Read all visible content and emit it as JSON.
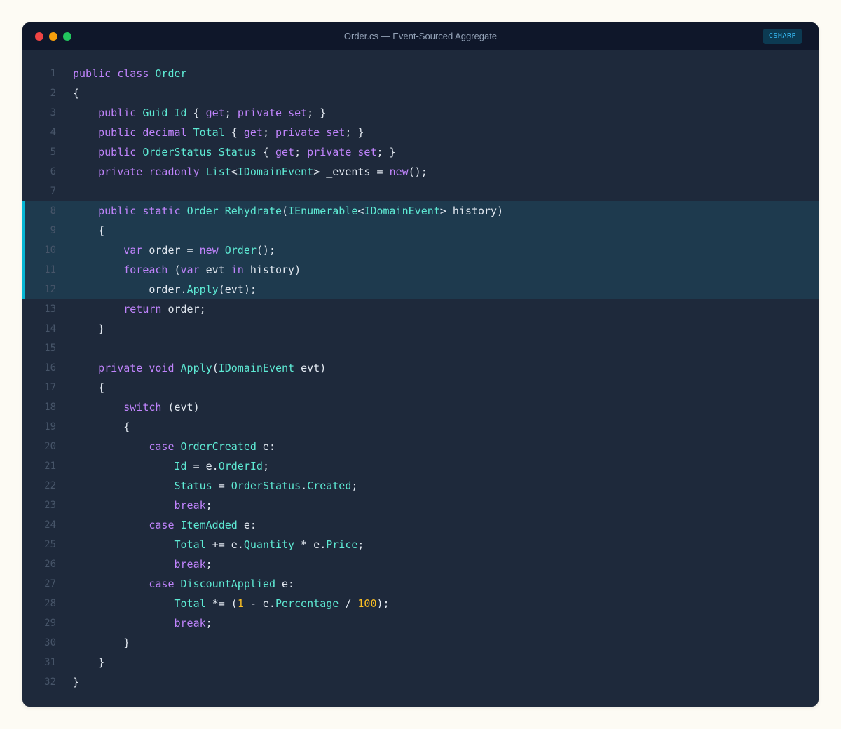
{
  "window": {
    "title": "Order.cs — Event-Sourced Aggregate",
    "language_badge": "CSHARP"
  },
  "colors": {
    "keyword": "#c084fc",
    "type": "#5eead4",
    "number": "#fbbf24",
    "text": "#e2e8f0",
    "highlight_bar": "#06b6d4"
  },
  "editor": {
    "highlighted_lines": [
      8,
      9,
      10,
      11,
      12
    ],
    "lines": [
      {
        "n": "1",
        "tokens": [
          [
            "kw",
            "public"
          ],
          [
            "tx",
            " "
          ],
          [
            "kw",
            "class"
          ],
          [
            "tx",
            " "
          ],
          [
            "ty",
            "Order"
          ]
        ]
      },
      {
        "n": "2",
        "tokens": [
          [
            "tx",
            "{"
          ]
        ]
      },
      {
        "n": "3",
        "tokens": [
          [
            "tx",
            "    "
          ],
          [
            "kw",
            "public"
          ],
          [
            "tx",
            " "
          ],
          [
            "ty",
            "Guid"
          ],
          [
            "tx",
            " "
          ],
          [
            "ty",
            "Id"
          ],
          [
            "tx",
            " { "
          ],
          [
            "kw",
            "get"
          ],
          [
            "tx",
            "; "
          ],
          [
            "kw",
            "private"
          ],
          [
            "tx",
            " "
          ],
          [
            "kw",
            "set"
          ],
          [
            "tx",
            "; }"
          ]
        ]
      },
      {
        "n": "4",
        "tokens": [
          [
            "tx",
            "    "
          ],
          [
            "kw",
            "public"
          ],
          [
            "tx",
            " "
          ],
          [
            "kw",
            "decimal"
          ],
          [
            "tx",
            " "
          ],
          [
            "ty",
            "Total"
          ],
          [
            "tx",
            " { "
          ],
          [
            "kw",
            "get"
          ],
          [
            "tx",
            "; "
          ],
          [
            "kw",
            "private"
          ],
          [
            "tx",
            " "
          ],
          [
            "kw",
            "set"
          ],
          [
            "tx",
            "; }"
          ]
        ]
      },
      {
        "n": "5",
        "tokens": [
          [
            "tx",
            "    "
          ],
          [
            "kw",
            "public"
          ],
          [
            "tx",
            " "
          ],
          [
            "ty",
            "OrderStatus"
          ],
          [
            "tx",
            " "
          ],
          [
            "ty",
            "Status"
          ],
          [
            "tx",
            " { "
          ],
          [
            "kw",
            "get"
          ],
          [
            "tx",
            "; "
          ],
          [
            "kw",
            "private"
          ],
          [
            "tx",
            " "
          ],
          [
            "kw",
            "set"
          ],
          [
            "tx",
            "; }"
          ]
        ]
      },
      {
        "n": "6",
        "tokens": [
          [
            "tx",
            "    "
          ],
          [
            "kw",
            "private"
          ],
          [
            "tx",
            " "
          ],
          [
            "kw",
            "readonly"
          ],
          [
            "tx",
            " "
          ],
          [
            "ty",
            "List"
          ],
          [
            "tx",
            "<"
          ],
          [
            "ty",
            "IDomainEvent"
          ],
          [
            "tx",
            "> _events = "
          ],
          [
            "kw",
            "new"
          ],
          [
            "tx",
            "();"
          ]
        ]
      },
      {
        "n": "7",
        "tokens": []
      },
      {
        "n": "8",
        "tokens": [
          [
            "tx",
            "    "
          ],
          [
            "kw",
            "public"
          ],
          [
            "tx",
            " "
          ],
          [
            "kw",
            "static"
          ],
          [
            "tx",
            " "
          ],
          [
            "ty",
            "Order"
          ],
          [
            "tx",
            " "
          ],
          [
            "ty",
            "Rehydrate"
          ],
          [
            "tx",
            "("
          ],
          [
            "ty",
            "IEnumerable"
          ],
          [
            "tx",
            "<"
          ],
          [
            "ty",
            "IDomainEvent"
          ],
          [
            "tx",
            "> history)"
          ]
        ]
      },
      {
        "n": "9",
        "tokens": [
          [
            "tx",
            "    {"
          ]
        ]
      },
      {
        "n": "10",
        "tokens": [
          [
            "tx",
            "        "
          ],
          [
            "kw",
            "var"
          ],
          [
            "tx",
            " order = "
          ],
          [
            "kw",
            "new"
          ],
          [
            "tx",
            " "
          ],
          [
            "ty",
            "Order"
          ],
          [
            "tx",
            "();"
          ]
        ]
      },
      {
        "n": "11",
        "tokens": [
          [
            "tx",
            "        "
          ],
          [
            "kw",
            "foreach"
          ],
          [
            "tx",
            " ("
          ],
          [
            "kw",
            "var"
          ],
          [
            "tx",
            " evt "
          ],
          [
            "kw",
            "in"
          ],
          [
            "tx",
            " history)"
          ]
        ]
      },
      {
        "n": "12",
        "tokens": [
          [
            "tx",
            "            order."
          ],
          [
            "ty",
            "Apply"
          ],
          [
            "tx",
            "(evt);"
          ]
        ]
      },
      {
        "n": "13",
        "tokens": [
          [
            "tx",
            "        "
          ],
          [
            "kw",
            "return"
          ],
          [
            "tx",
            " order;"
          ]
        ]
      },
      {
        "n": "14",
        "tokens": [
          [
            "tx",
            "    }"
          ]
        ]
      },
      {
        "n": "15",
        "tokens": []
      },
      {
        "n": "16",
        "tokens": [
          [
            "tx",
            "    "
          ],
          [
            "kw",
            "private"
          ],
          [
            "tx",
            " "
          ],
          [
            "kw",
            "void"
          ],
          [
            "tx",
            " "
          ],
          [
            "ty",
            "Apply"
          ],
          [
            "tx",
            "("
          ],
          [
            "ty",
            "IDomainEvent"
          ],
          [
            "tx",
            " evt)"
          ]
        ]
      },
      {
        "n": "17",
        "tokens": [
          [
            "tx",
            "    {"
          ]
        ]
      },
      {
        "n": "18",
        "tokens": [
          [
            "tx",
            "        "
          ],
          [
            "kw",
            "switch"
          ],
          [
            "tx",
            " (evt)"
          ]
        ]
      },
      {
        "n": "19",
        "tokens": [
          [
            "tx",
            "        {"
          ]
        ]
      },
      {
        "n": "20",
        "tokens": [
          [
            "tx",
            "            "
          ],
          [
            "kw",
            "case"
          ],
          [
            "tx",
            " "
          ],
          [
            "ty",
            "OrderCreated"
          ],
          [
            "tx",
            " e:"
          ]
        ]
      },
      {
        "n": "21",
        "tokens": [
          [
            "tx",
            "                "
          ],
          [
            "ty",
            "Id"
          ],
          [
            "tx",
            " = e."
          ],
          [
            "ty",
            "OrderId"
          ],
          [
            "tx",
            ";"
          ]
        ]
      },
      {
        "n": "22",
        "tokens": [
          [
            "tx",
            "                "
          ],
          [
            "ty",
            "Status"
          ],
          [
            "tx",
            " = "
          ],
          [
            "ty",
            "OrderStatus"
          ],
          [
            "tx",
            "."
          ],
          [
            "ty",
            "Created"
          ],
          [
            "tx",
            ";"
          ]
        ]
      },
      {
        "n": "23",
        "tokens": [
          [
            "tx",
            "                "
          ],
          [
            "kw",
            "break"
          ],
          [
            "tx",
            ";"
          ]
        ]
      },
      {
        "n": "24",
        "tokens": [
          [
            "tx",
            "            "
          ],
          [
            "kw",
            "case"
          ],
          [
            "tx",
            " "
          ],
          [
            "ty",
            "ItemAdded"
          ],
          [
            "tx",
            " e:"
          ]
        ]
      },
      {
        "n": "25",
        "tokens": [
          [
            "tx",
            "                "
          ],
          [
            "ty",
            "Total"
          ],
          [
            "tx",
            " += e."
          ],
          [
            "ty",
            "Quantity"
          ],
          [
            "tx",
            " * e."
          ],
          [
            "ty",
            "Price"
          ],
          [
            "tx",
            ";"
          ]
        ]
      },
      {
        "n": "26",
        "tokens": [
          [
            "tx",
            "                "
          ],
          [
            "kw",
            "break"
          ],
          [
            "tx",
            ";"
          ]
        ]
      },
      {
        "n": "27",
        "tokens": [
          [
            "tx",
            "            "
          ],
          [
            "kw",
            "case"
          ],
          [
            "tx",
            " "
          ],
          [
            "ty",
            "DiscountApplied"
          ],
          [
            "tx",
            " e:"
          ]
        ]
      },
      {
        "n": "28",
        "tokens": [
          [
            "tx",
            "                "
          ],
          [
            "ty",
            "Total"
          ],
          [
            "tx",
            " *= ("
          ],
          [
            "nu",
            "1"
          ],
          [
            "tx",
            " - e."
          ],
          [
            "ty",
            "Percentage"
          ],
          [
            "tx",
            " / "
          ],
          [
            "nu",
            "100"
          ],
          [
            "tx",
            ");"
          ]
        ]
      },
      {
        "n": "29",
        "tokens": [
          [
            "tx",
            "                "
          ],
          [
            "kw",
            "break"
          ],
          [
            "tx",
            ";"
          ]
        ]
      },
      {
        "n": "30",
        "tokens": [
          [
            "tx",
            "        }"
          ]
        ]
      },
      {
        "n": "31",
        "tokens": [
          [
            "tx",
            "    }"
          ]
        ]
      },
      {
        "n": "32",
        "tokens": [
          [
            "tx",
            "}"
          ]
        ]
      }
    ]
  }
}
